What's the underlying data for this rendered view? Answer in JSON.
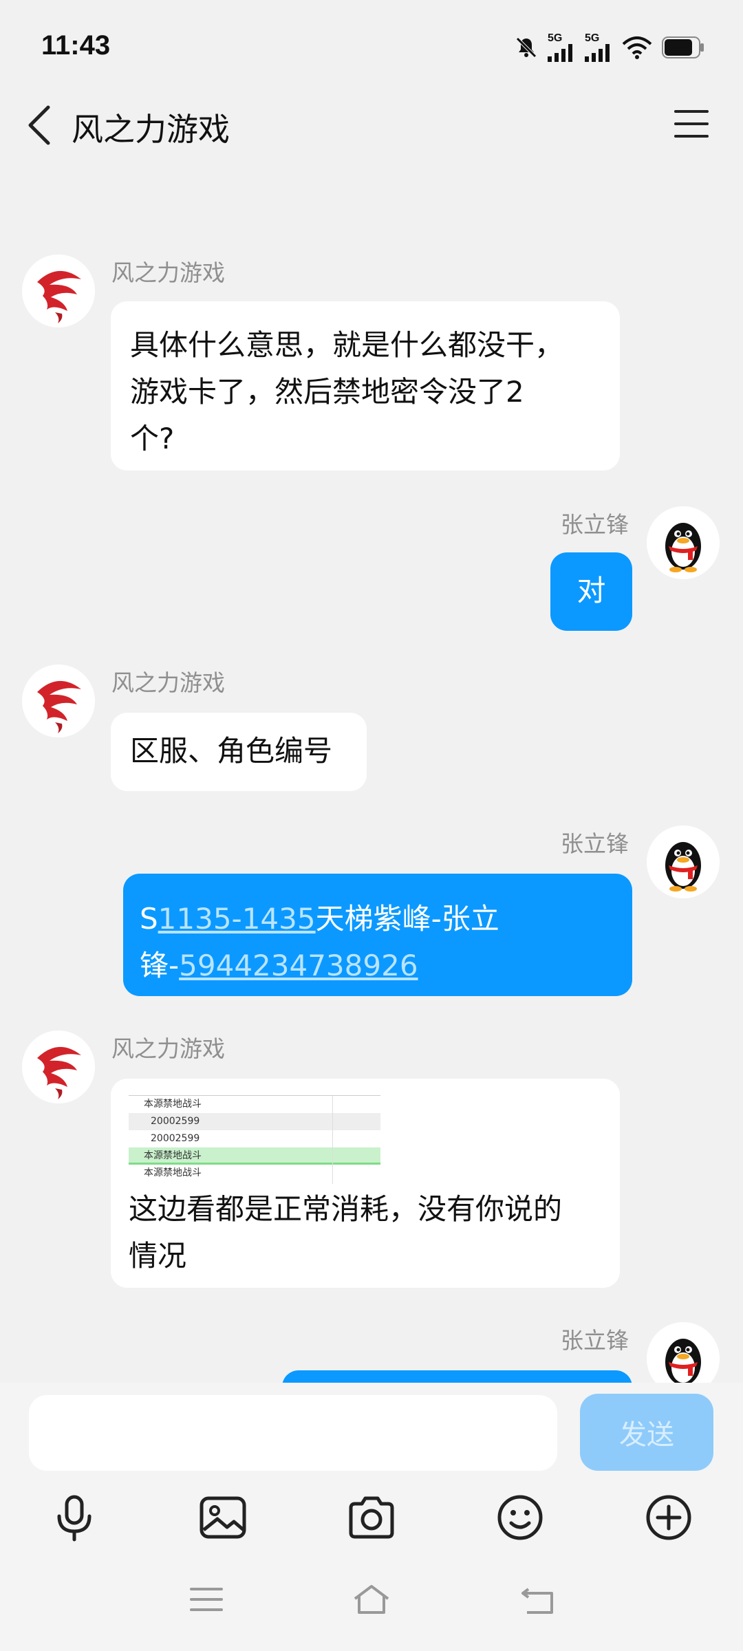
{
  "status_bar": {
    "time": "11:43",
    "signal1_label": "5G",
    "signal2_label": "5G",
    "icons": [
      "mute-bell-icon",
      "signal-5g-icon",
      "signal-5g-icon",
      "wifi-icon",
      "battery-icon"
    ]
  },
  "header": {
    "title": "风之力游戏",
    "back_icon": "chevron-left-icon",
    "menu_icon": "menu-icon"
  },
  "messages": [
    {
      "side": "in",
      "sender": "风之力游戏",
      "lines": [
        "具体什么意思，就是什么都没干，",
        "游戏卡了，然后禁地密令没了2",
        "个?"
      ]
    },
    {
      "side": "out",
      "sender": "张立锋",
      "text": "对"
    },
    {
      "side": "in",
      "sender": "风之力游戏",
      "text": "区服、角色编号"
    },
    {
      "side": "out",
      "sender": "张立锋",
      "parts": {
        "p1": "S",
        "link1": "1135-1435",
        "p2": "天梯紫峰-张立",
        "p3": "锋-",
        "link2": "5944234738926"
      }
    },
    {
      "side": "in",
      "sender": "风之力游戏",
      "image_rows": [
        "本源禁地战斗",
        "20002599",
        "20002599",
        "本源禁地战斗",
        "本源禁地战斗"
      ],
      "lines": [
        "这边看都是正常消耗，没有你说的",
        "情况"
      ]
    },
    {
      "side": "out",
      "sender": "张立锋"
    }
  ],
  "composer": {
    "input_value": "",
    "send_label": "发送"
  },
  "toolbar": [
    "microphone-icon",
    "image-icon",
    "camera-icon",
    "emoji-icon",
    "plus-icon"
  ],
  "nav_bar": [
    "menu-icon",
    "home-icon",
    "back-icon"
  ],
  "colors": {
    "accent": "#0b99ff",
    "background": "#f1f1f1",
    "send_disabled": "#8ecbfa"
  }
}
